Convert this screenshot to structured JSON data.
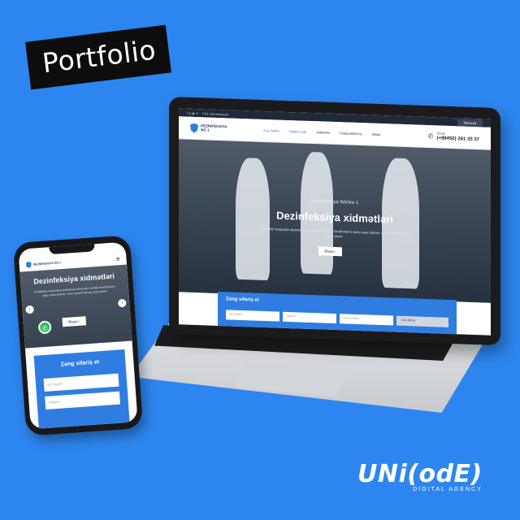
{
  "portfolio_label": "Portfolio",
  "brand": {
    "name": "UNi(odE)",
    "tagline": "DIGITAL AGENCY"
  },
  "laptop": {
    "topbar": {
      "hours": "7/24 xidmetindeyik",
      "apply_label": "Müraciət"
    },
    "logo": {
      "line1": "DEZINFEKSIYA",
      "line2": "NO 1"
    },
    "nav": [
      "Ana Səhifə",
      "Haqqımızda",
      "Xidmətlər",
      "Fəaliyyətlərimiz",
      "Əlaqə"
    ],
    "phone": {
      "label": "Əlaqə",
      "number": "(+99450) 261 35 37"
    },
    "hero": {
      "subtitle": "Dezinfeksiya Nömrə 1",
      "title": "Dezinfeksiya xidmətləri",
      "description": "Profilaktik məqsədlə dezinfeksiya infeksion xəstəlik törədicilərinə qarşı əsas silahdır, onun şəraitin almaq üçün işlənir.",
      "button": "Əlaqə"
    },
    "order": {
      "title": "Zəng sifariş et",
      "fields": [
        "Ad Soyad*",
        "Telefon*",
        "Xidmət seçin"
      ],
      "submit": "Geri dönüş"
    }
  },
  "phone": {
    "logo": "DEZINFEKSIYA NO 1",
    "hero": {
      "title": "Dezinfeksiya xidmətləri",
      "description": "Profilaktik məqsədlə dezinfeksiya infeksion xəstəlik törədicilərinə qarşı əsas silahdır, onun şəraitin almaq üçün işlənir.",
      "button": "Əlaqə"
    },
    "order": {
      "title": "Zəng sifariş et",
      "fields": [
        "Ad Soyad*",
        "Telefon*"
      ]
    }
  }
}
